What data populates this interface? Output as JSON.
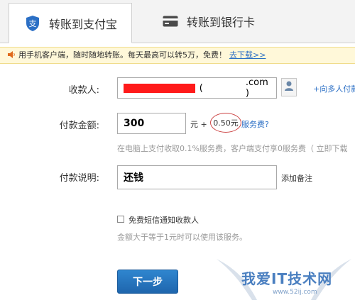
{
  "tabs": [
    {
      "label": "转账到支付宝",
      "icon": "alipay-shield-icon",
      "active": true
    },
    {
      "label": "转账到银行卡",
      "icon": "bank-card-icon",
      "active": false
    }
  ],
  "notice": {
    "icon": "speaker-icon",
    "text": "用手机客户端，随时随地转账。每天最高可以转5万，免费！",
    "link": "去下载>>"
  },
  "form": {
    "recipient": {
      "label": "收款人:",
      "value_suffix": ".com )",
      "icon": "contacts-icon",
      "link": "+向多人付款"
    },
    "amount": {
      "label": "付款金额:",
      "value": "300",
      "unit": "元 +",
      "fee": "0.50元",
      "fee_link": "服务费?",
      "hint": "在电脑上支付收取0.1%服务费，客户端支付享0服务费（ 立即下载"
    },
    "note": {
      "label": "付款说明:",
      "value": "还钱",
      "add_note": "添加备注"
    },
    "sms": {
      "label": "免费短信通知收款人",
      "checked": false,
      "hint": "金额大于等于1元时可以使用该服务。"
    },
    "submit": "下一步"
  },
  "watermark": {
    "text": "我爱IT技术网",
    "url": "www.52ij.com"
  },
  "colors": {
    "link": "#2b6fc5",
    "redaction": "#ff1a1a",
    "button": "#1f66ad",
    "notice_bg": "#fff8d9"
  }
}
